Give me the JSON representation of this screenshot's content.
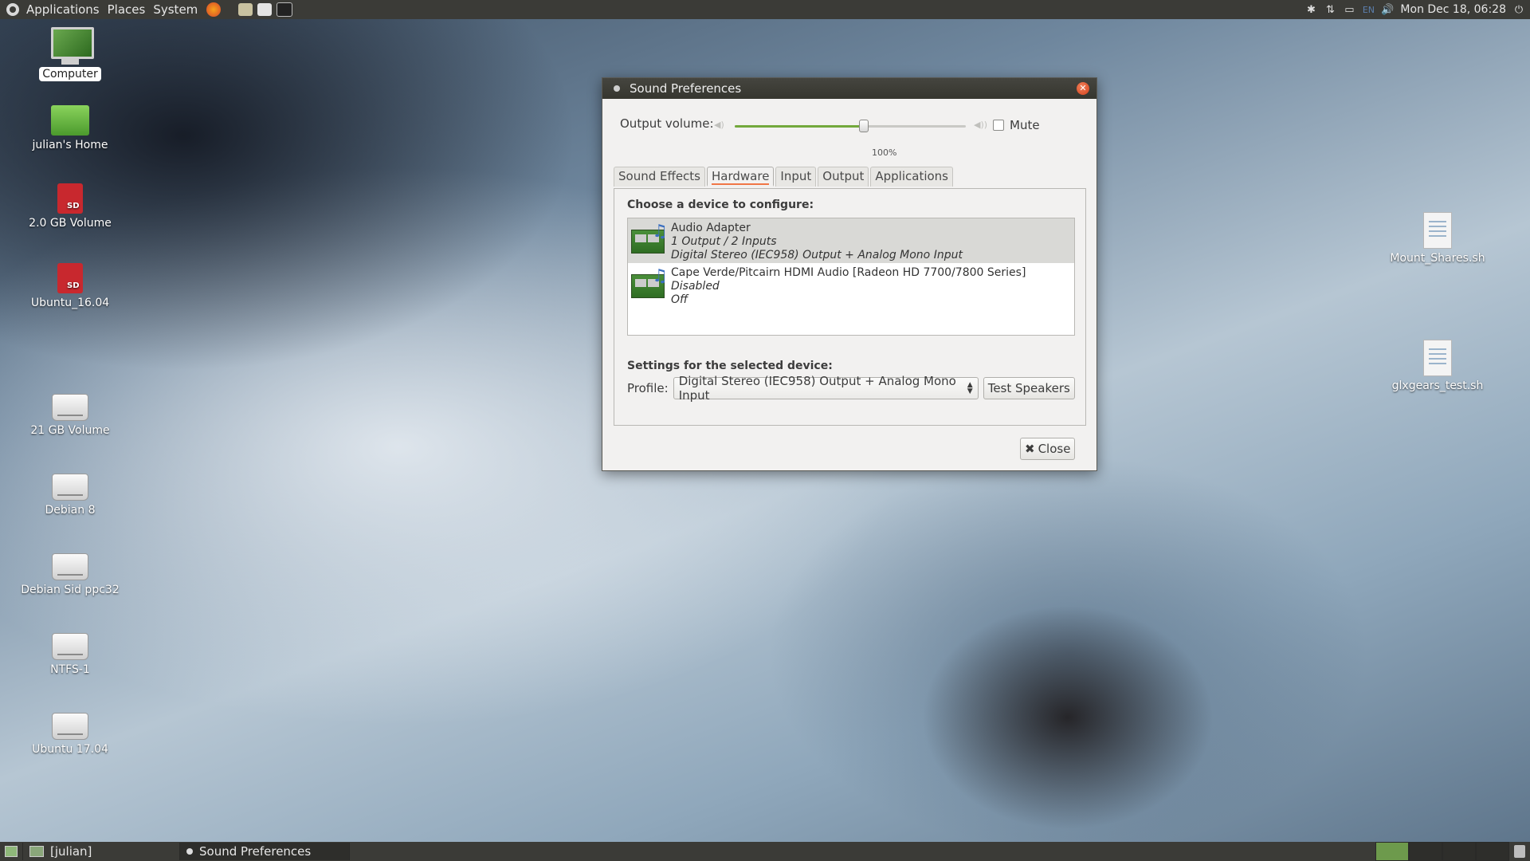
{
  "top_panel": {
    "menus": [
      "Applications",
      "Places",
      "System"
    ],
    "clock": "Mon Dec 18, 06:28",
    "keyboard_layout": "EN"
  },
  "desktop_icons": [
    {
      "label": "Computer",
      "icon": "computer-icon"
    },
    {
      "label": "julian's Home",
      "icon": "home-folder-icon"
    },
    {
      "label": "2.0 GB Volume",
      "icon": "sd-card-icon"
    },
    {
      "label": "Ubuntu_16.04",
      "icon": "sd-card-icon"
    },
    {
      "label": "21 GB Volume",
      "icon": "drive-icon"
    },
    {
      "label": "Debian 8",
      "icon": "drive-icon"
    },
    {
      "label": "Debian Sid ppc32",
      "icon": "drive-icon"
    },
    {
      "label": "NTFS-1",
      "icon": "drive-icon"
    },
    {
      "label": "Ubuntu 17.04",
      "icon": "drive-icon"
    },
    {
      "label": "Mount_Shares.sh",
      "icon": "script-file-icon"
    },
    {
      "label": "glxgears_test.sh",
      "icon": "script-file-icon"
    }
  ],
  "dialog": {
    "title": "Sound Preferences",
    "output_volume_label": "Output volume:",
    "volume_percent_label": "100%",
    "volume_level": 0.56,
    "mute_label": "Mute",
    "tabs": [
      "Sound Effects",
      "Hardware",
      "Input",
      "Output",
      "Applications"
    ],
    "active_tab": "Hardware",
    "choose_device_label": "Choose a device to configure:",
    "devices": [
      {
        "name": "Audio Adapter",
        "line1": "1 Output / 2 Inputs",
        "line2": "Digital Stereo (IEC958) Output + Analog Mono Input"
      },
      {
        "name": "Cape Verde/Pitcairn HDMI Audio [Radeon HD 7700/7800 Series]",
        "line1": "Disabled",
        "line2": "Off"
      }
    ],
    "settings_label": "Settings for the selected device:",
    "profile_label": "Profile:",
    "profile_value": "Digital Stereo (IEC958) Output + Analog Mono Input",
    "test_speakers_label": "Test Speakers",
    "close_label": "Close"
  },
  "taskbar": {
    "items": [
      "[julian]",
      "Sound Preferences"
    ]
  }
}
